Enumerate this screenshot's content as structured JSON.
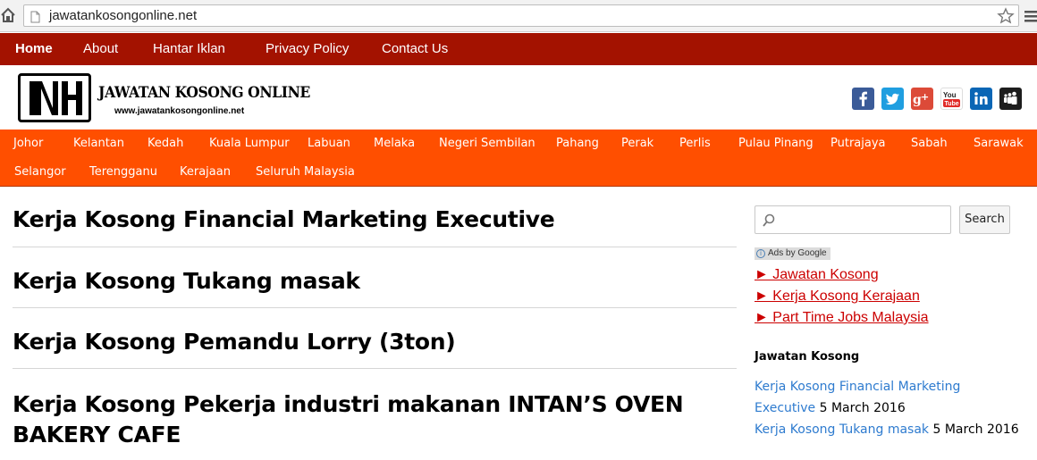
{
  "browser": {
    "url": "jawatankosongonline.net"
  },
  "topnav": {
    "items": [
      "Home",
      "About",
      "Hantar Iklan",
      "Privacy Policy",
      "Contact Us"
    ]
  },
  "header": {
    "logo_title": "JAWATAN KOSONG ONLINE",
    "logo_sub": "www.jawatankosongonline.net",
    "social_icons": [
      "facebook-icon",
      "twitter-icon",
      "google-plus-icon",
      "youtube-icon",
      "linkedin-icon",
      "myspace-icon"
    ]
  },
  "regionnav": {
    "row1": [
      "Johor",
      "Kelantan",
      "Kedah",
      "Kuala Lumpur",
      "Labuan",
      "Melaka",
      "Negeri Sembilan",
      "Pahang",
      "Perak",
      "Perlis",
      "Pulau Pinang",
      "Putrajaya",
      "Sabah",
      "Sarawak"
    ],
    "row2": [
      "Selangor",
      "Terengganu",
      "Kerajaan",
      "Seluruh Malaysia"
    ]
  },
  "posts": [
    {
      "title": "Kerja Kosong Financial Marketing Executive"
    },
    {
      "title": "Kerja Kosong Tukang masak"
    },
    {
      "title": "Kerja Kosong Pemandu Lorry (3ton)"
    },
    {
      "title": "Kerja Kosong Pekerja industri makanan INTAN’S OVEN BAKERY CAFE"
    }
  ],
  "sidebar": {
    "search_placeholder": "",
    "search_button": "Search",
    "ads_label": "Ads by Google",
    "ad_links": [
      "► Jawatan Kosong",
      "► Kerja Kosong Kerajaan",
      "► Part Time Jobs Malaysia"
    ],
    "widget_title": "Jawatan Kosong",
    "recent": [
      {
        "link": "Kerja Kosong Financial Marketing Executive",
        "date": "5 March 2016"
      },
      {
        "link": "Kerja Kosong Tukang masak",
        "date": "5 March 2016"
      }
    ]
  },
  "colors": {
    "top_nav_bg": "#a31200",
    "region_nav_bg": "#ff4f00",
    "ad_link": "#cc0000",
    "recent_link": "#2e7bcf"
  }
}
